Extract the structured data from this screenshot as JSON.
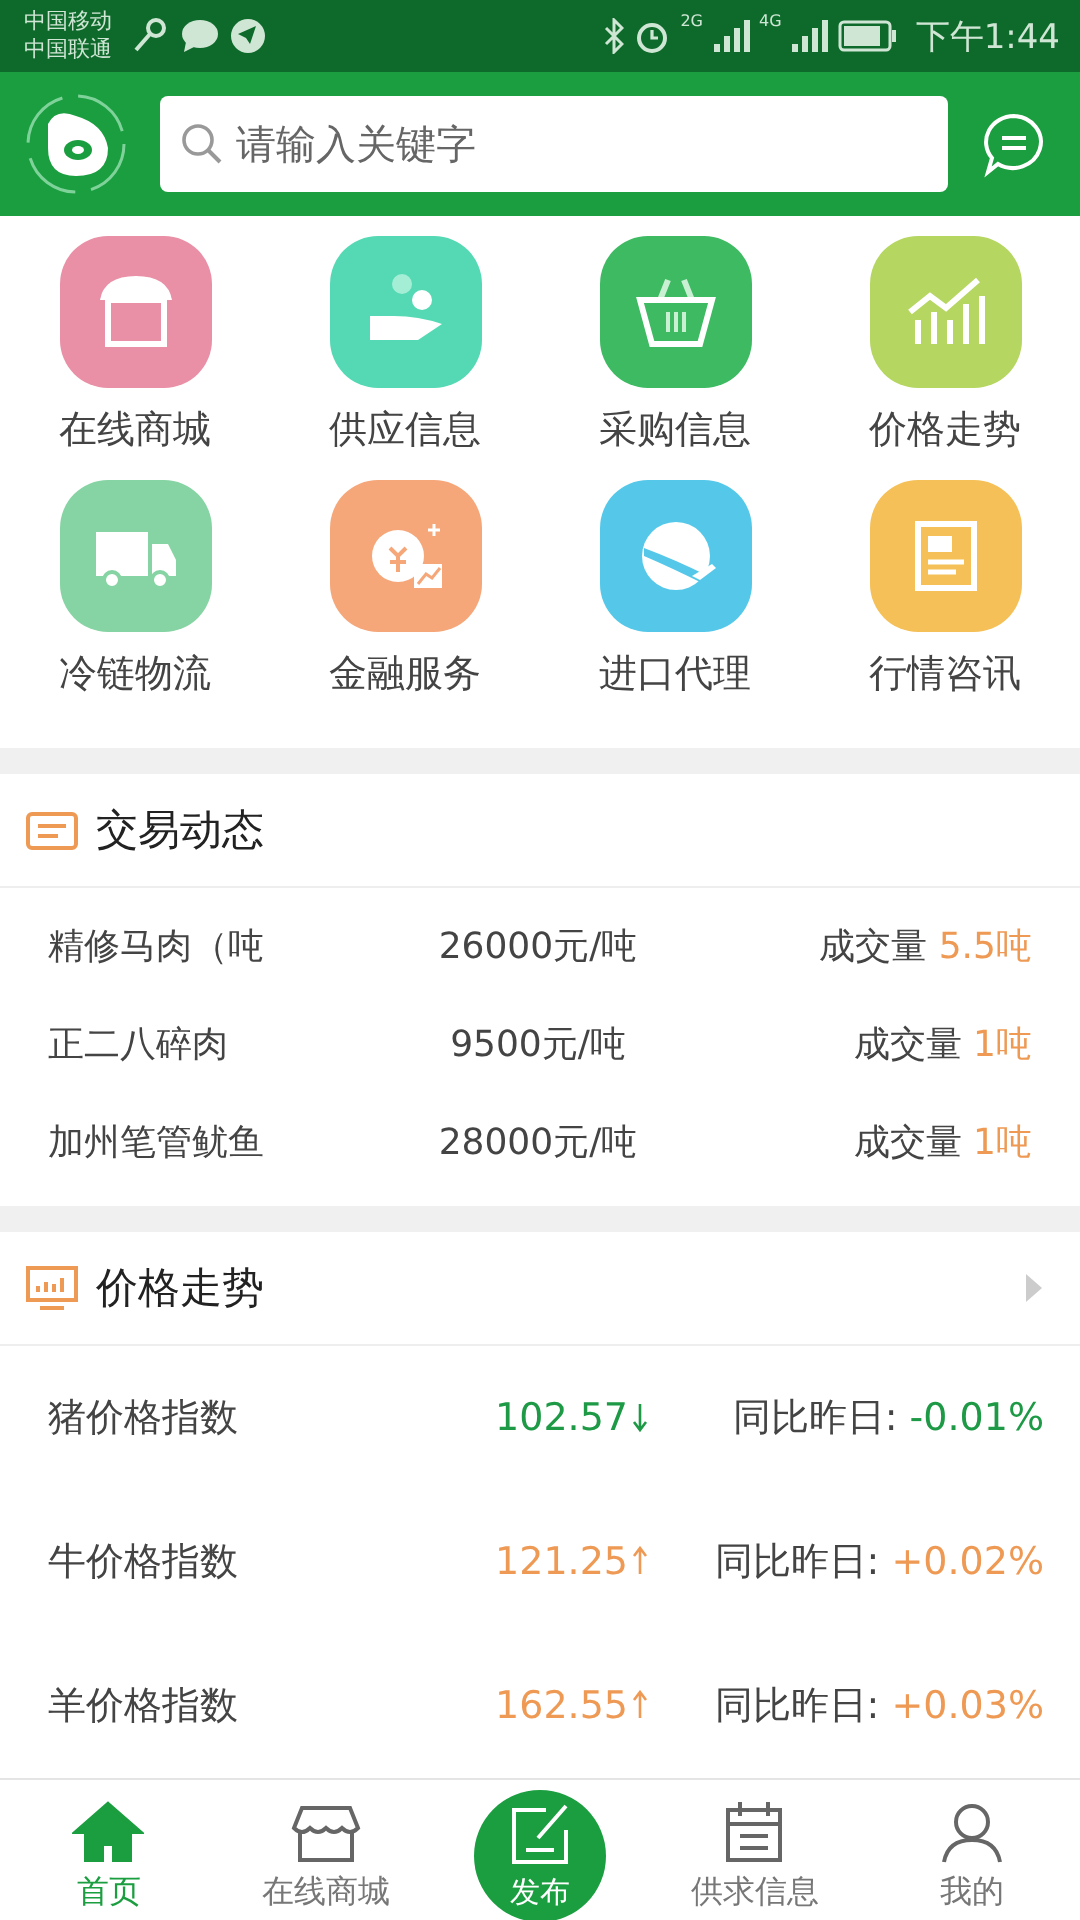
{
  "status_bar": {
    "carriers": [
      "中国移动",
      "中国联通"
    ],
    "network_1": "2G",
    "network_2": "4G",
    "time": "下午1:44"
  },
  "search": {
    "placeholder": "请输入关键字"
  },
  "categories": [
    {
      "label": "在线商城",
      "kind": "store",
      "color": "#e98fa6"
    },
    {
      "label": "供应信息",
      "kind": "supply",
      "color": "#55d9b4"
    },
    {
      "label": "采购信息",
      "kind": "basket",
      "color": "#3dba62"
    },
    {
      "label": "价格走势",
      "kind": "chart",
      "color": "#b5d660"
    },
    {
      "label": "冷链物流",
      "kind": "truck",
      "color": "#86d4a3"
    },
    {
      "label": "金融服务",
      "kind": "finance",
      "color": "#f5a77a"
    },
    {
      "label": "进口代理",
      "kind": "globe",
      "color": "#55c8ea"
    },
    {
      "label": "行情咨讯",
      "kind": "news",
      "color": "#f5c057"
    }
  ],
  "trades": {
    "title": "交易动态",
    "rows": [
      {
        "name": "精修马肉（吨",
        "price": "26000元/吨",
        "volume_label": "成交量",
        "volume": "5.5吨"
      },
      {
        "name": "正二八碎肉",
        "price": "9500元/吨",
        "volume_label": "成交量",
        "volume": "1吨"
      },
      {
        "name": "加州笔管鱿鱼",
        "price": "28000元/吨",
        "volume_label": "成交量",
        "volume": "1吨"
      }
    ]
  },
  "prices": {
    "title": "价格走势",
    "rows": [
      {
        "name": "猪价格指数",
        "value": "102.57",
        "kind": "down",
        "change_label": "同比昨日:",
        "change": "-0.01%"
      },
      {
        "name": "牛价格指数",
        "value": "121.25",
        "kind": "up",
        "change_label": "同比昨日:",
        "change": "+0.02%"
      },
      {
        "name": "羊价格指数",
        "value": "162.55",
        "kind": "up",
        "change_label": "同比昨日:",
        "change": "+0.03%"
      }
    ]
  },
  "nav": [
    {
      "label": "首页",
      "kind": "home",
      "selected": true
    },
    {
      "label": "在线商城",
      "kind": "store",
      "selected": false
    },
    {
      "label": "发布",
      "kind": "publish",
      "selected": false
    },
    {
      "label": "供求信息",
      "kind": "calendar",
      "selected": false
    },
    {
      "label": "我的",
      "kind": "user",
      "selected": false
    }
  ]
}
